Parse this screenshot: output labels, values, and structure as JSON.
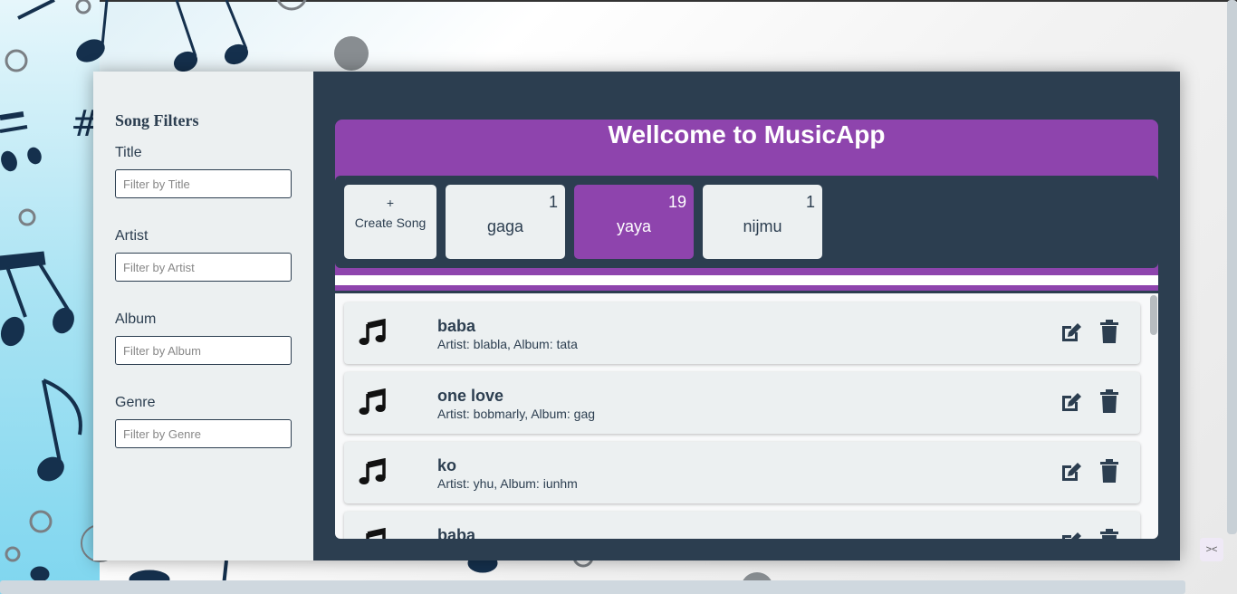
{
  "sidebar": {
    "heading": "Song Filters",
    "filters": [
      {
        "label": "Title",
        "placeholder": "Filter by Title",
        "value": ""
      },
      {
        "label": "Artist",
        "placeholder": "Filter by Artist",
        "value": ""
      },
      {
        "label": "Album",
        "placeholder": "Filter by Album",
        "value": ""
      },
      {
        "label": "Genre",
        "placeholder": "Filter by Genre",
        "value": ""
      }
    ]
  },
  "header": {
    "title": "Wellcome to MusicApp"
  },
  "tabs": {
    "create": {
      "plus": "+",
      "label": "Create Song"
    },
    "items": [
      {
        "name": "gaga",
        "count": "1",
        "active": false
      },
      {
        "name": "yaya",
        "count": "19",
        "active": true
      },
      {
        "name": "nijmu",
        "count": "1",
        "active": false
      }
    ]
  },
  "songs": [
    {
      "title": "baba",
      "meta": "Artist: blabla, Album: tata"
    },
    {
      "title": "one love",
      "meta": "Artist: bobmarly, Album: gag"
    },
    {
      "title": "ko",
      "meta": "Artist: yhu, Album: iunhm"
    },
    {
      "title": "baba",
      "meta": ""
    }
  ],
  "icons": {
    "song": "music-note-icon",
    "edit": "edit-icon",
    "delete": "trash-icon"
  },
  "colors": {
    "accent": "#8e44ad",
    "dark": "#2c3e50",
    "light": "#ecf0f1"
  },
  "corner_badge": "><"
}
